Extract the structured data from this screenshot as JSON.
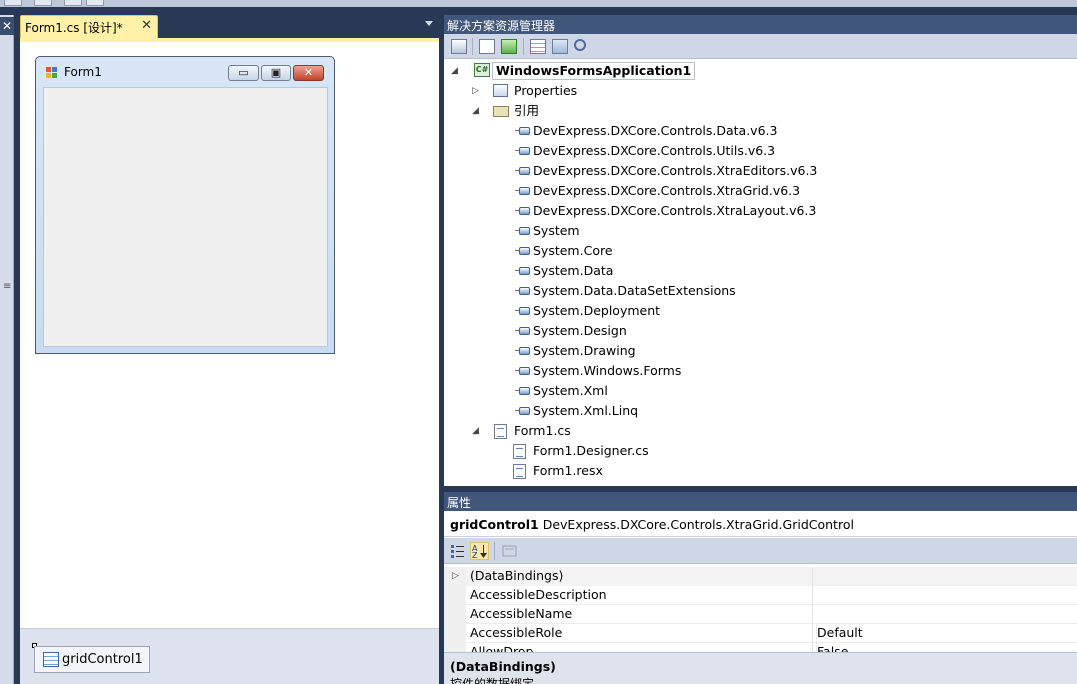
{
  "designer": {
    "tab_label": "Form1.cs [设计]*",
    "tab_close": "✕",
    "form_title": "Form1",
    "tray_item_label": "gridControl1",
    "window_buttons": {
      "minimize": "▭",
      "maximize": "▣",
      "close": "✕"
    }
  },
  "left_strip": {
    "close_glyph": "✕",
    "grip": "≡"
  },
  "solution_explorer": {
    "title": "解决方案资源管理器",
    "project": "WindowsFormsApplication1",
    "project_icon_text": "C#",
    "items": {
      "properties": "Properties",
      "references": "引用",
      "refs": [
        "DevExpress.DXCore.Controls.Data.v6.3",
        "DevExpress.DXCore.Controls.Utils.v6.3",
        "DevExpress.DXCore.Controls.XtraEditors.v6.3",
        "DevExpress.DXCore.Controls.XtraGrid.v6.3",
        "DevExpress.DXCore.Controls.XtraLayout.v6.3",
        "System",
        "System.Core",
        "System.Data",
        "System.Data.DataSetExtensions",
        "System.Deployment",
        "System.Design",
        "System.Drawing",
        "System.Windows.Forms",
        "System.Xml",
        "System.Xml.Linq"
      ],
      "form_file": "Form1.cs",
      "form_children": [
        "Form1.Designer.cs",
        "Form1.resx"
      ]
    }
  },
  "properties": {
    "title": "属性",
    "object_name": "gridControl1",
    "object_type": "DevExpress.DXCore.Controls.XtraGrid.GridControl",
    "rows": [
      {
        "name": "(DataBindings)",
        "value": ""
      },
      {
        "name": "AccessibleDescription",
        "value": ""
      },
      {
        "name": "AccessibleName",
        "value": ""
      },
      {
        "name": "AccessibleRole",
        "value": "Default"
      },
      {
        "name": "AllowDrop",
        "value": "False"
      }
    ],
    "description_title": "(DataBindings)",
    "description_text": "控件的数据绑定。"
  },
  "colors": {
    "frame": "#293955",
    "panel_title": "#40567b",
    "active_tab": "#fff1a8",
    "toolbar": "#cfd6e5"
  }
}
